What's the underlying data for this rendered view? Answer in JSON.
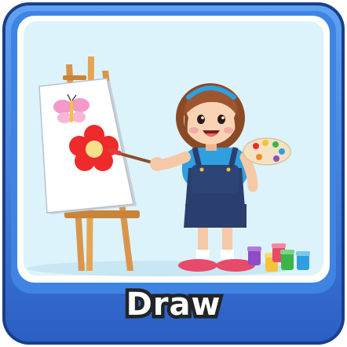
{
  "card": {
    "label": "Draw",
    "frame_color": "#2F6FD6",
    "frame_highlight": "#5FA2F2",
    "panel_color": "#DDF3FC",
    "illustration": "girl-painting-flower-on-easel"
  }
}
